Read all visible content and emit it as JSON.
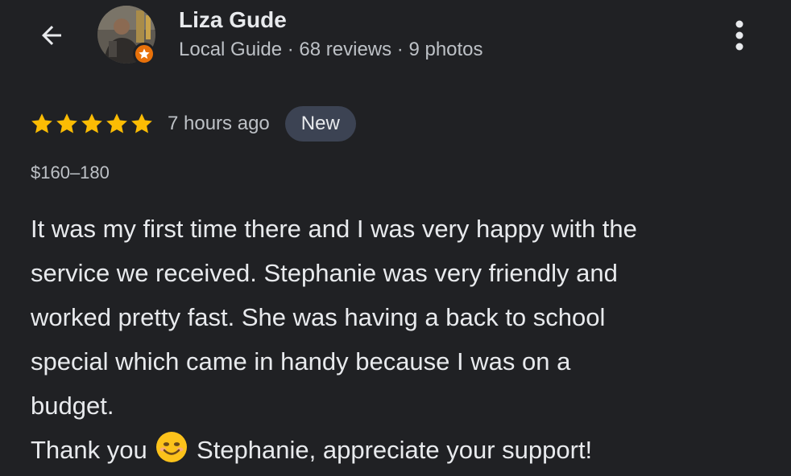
{
  "header": {
    "user_name": "Liza Gude",
    "user_meta": "Local Guide · 68 reviews · 9 photos",
    "back_icon": "arrow-back-icon",
    "more_icon": "more-vert-icon",
    "badge_icon": "local-guide-star-icon"
  },
  "review": {
    "rating": 5,
    "max_rating": 5,
    "time_ago": "7 hours ago",
    "new_label": "New",
    "price_range": "$160–180",
    "lines": [
      "It was my first time there and I was very happy with the",
      "service we received. Stephanie was very friendly and",
      "worked pretty fast. She was having a back to school",
      "special which came in handy because I was on a",
      "budget."
    ],
    "last_line_before": "Thank you",
    "last_line_emoji": "smiling-face-icon",
    "last_line_after": "Stephanie, appreciate your support!"
  },
  "colors": {
    "background": "#202124",
    "star": "#fbbc04",
    "badge": "#e8710a",
    "new_chip": "#3c4353"
  }
}
